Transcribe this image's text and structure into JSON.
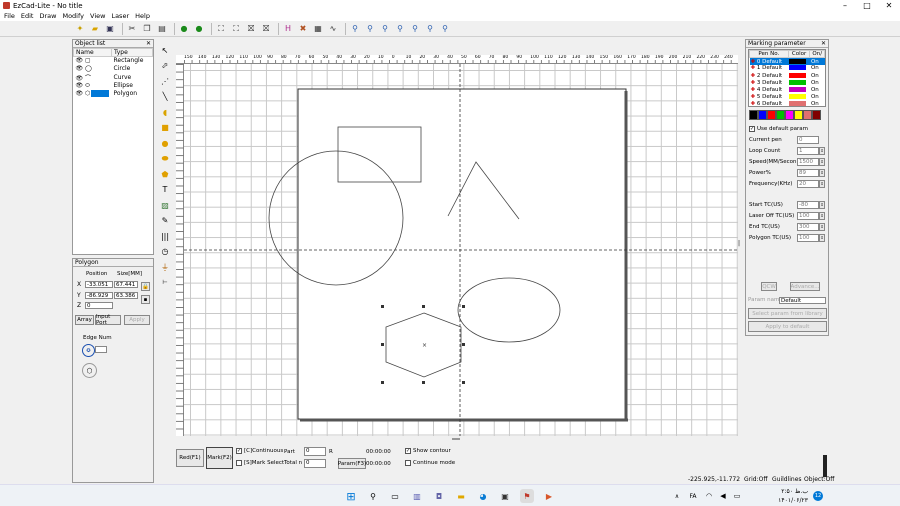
{
  "window": {
    "title": "EzCad-Lite - No title",
    "controls": [
      "–",
      "□",
      "✕"
    ]
  },
  "menu": [
    "File",
    "Edit",
    "Draw",
    "Modify",
    "View",
    "Laser",
    "Help"
  ],
  "object_list": {
    "title": "Object list",
    "headers": [
      "Name",
      "Type"
    ],
    "rows": [
      {
        "type": "Rectangle"
      },
      {
        "type": "Circle"
      },
      {
        "type": "Curve"
      },
      {
        "type": "Ellipse"
      },
      {
        "type": "Polygon",
        "selected": true
      }
    ]
  },
  "polygon_panel": {
    "title": "Polygon",
    "position_label": "Position",
    "size_label": "Size[MM]",
    "x_label": "X",
    "y_label": "Y",
    "z_label": "Z",
    "x": "-33.051",
    "y": "-86.929",
    "z": "0",
    "w": "67.441",
    "h": "63.386",
    "array_btn": "Array",
    "input_port_btn": "Input Port",
    "apply_btn": "Apply",
    "edge_num_label": "Edge Num",
    "edge_num": "6"
  },
  "ruler": {
    "top_labels": [
      "-140",
      "-120",
      "-100",
      "-80",
      "-60",
      "-40",
      "-20",
      "0",
      "20",
      "40",
      "60",
      "80",
      "100",
      "120",
      "140",
      "160",
      "180",
      "200",
      "220",
      "240"
    ],
    "top_extra": [
      "150",
      "140",
      "130",
      "120",
      "110",
      "100",
      "90",
      "80",
      "70",
      "60",
      "50",
      "40",
      "30",
      "20",
      "10",
      "0",
      "10",
      "20",
      "30",
      "40",
      "50",
      "60",
      "70",
      "80",
      "90",
      "100",
      "110",
      "120",
      "130",
      "140",
      "150",
      "160",
      "170",
      "180",
      "190",
      "200",
      "210",
      "220",
      "230",
      "240"
    ]
  },
  "bottom_controls": {
    "red_btn": "Red(F1)",
    "mark_btn": "Mark(F2)",
    "continuous_label": "[C]Continuous",
    "mark_select_label": "[S]Mark Select",
    "part_label": "Part",
    "part_value": "0",
    "r_btn": "R",
    "total_label": "Total n",
    "total_value": "0",
    "time1": "00:00:00",
    "time2": "00:00:00",
    "param_btn": "Param(F3)",
    "show_contour": "Show contour",
    "continue_mode": "Continue mode"
  },
  "marking": {
    "title": "Marking parameter",
    "headers": [
      "Pen No.",
      "Color",
      "On/"
    ],
    "pens": [
      {
        "name": "0 Default",
        "color": "#000000",
        "on": "On"
      },
      {
        "name": "1 Default",
        "color": "#0000ff",
        "on": "On"
      },
      {
        "name": "2 Default",
        "color": "#ff0000",
        "on": "On"
      },
      {
        "name": "3 Default",
        "color": "#00c000",
        "on": "On"
      },
      {
        "name": "4 Default",
        "color": "#c000c0",
        "on": "On"
      },
      {
        "name": "5 Default",
        "color": "#ffff00",
        "on": "On"
      },
      {
        "name": "6 Default",
        "color": "#e07070",
        "on": "On"
      },
      {
        "name": "7 Default",
        "color": "#a0a0a0",
        "on": "On"
      }
    ],
    "palette": [
      "#000000",
      "#0000ff",
      "#ff0000",
      "#00c000",
      "#ff00ff",
      "#ffff00",
      "#e07070",
      "#800000"
    ],
    "use_default": "Use default param",
    "params": [
      {
        "label": "Current pen",
        "value": "0",
        "spin": false
      },
      {
        "label": "Loop Count",
        "value": "1",
        "spin": true
      },
      {
        "label": "Speed(MM/Secon",
        "value": "1500",
        "spin": true
      },
      {
        "label": "Power%",
        "value": "89",
        "spin": true
      },
      {
        "label": "Frequency(KHz)",
        "value": "20",
        "spin": true
      }
    ],
    "params2": [
      {
        "label": "Start TC(US)",
        "value": "-80"
      },
      {
        "label": "Laser Off TC(US)",
        "value": "100"
      },
      {
        "label": "End TC(US)",
        "value": "300"
      },
      {
        "label": "Polygon TC(US)",
        "value": "100"
      }
    ],
    "qcw_btn": "QCW",
    "advance_btn": "Advance...",
    "param_name_label": "Param name",
    "param_name": "Default",
    "select_btn": "Select param from library",
    "apply_btn": "Apply to default"
  },
  "status": {
    "coords": "-225.925,-11.772",
    "grid": "Grid:Off",
    "guidlines": "Guildlines",
    "object": "Object:Off"
  },
  "taskbar": {
    "time": "۲:۵۰ ب.ظ",
    "date": "۱۴۰۱/۰۶/۲۳",
    "lang": "FA",
    "badge": "12"
  }
}
